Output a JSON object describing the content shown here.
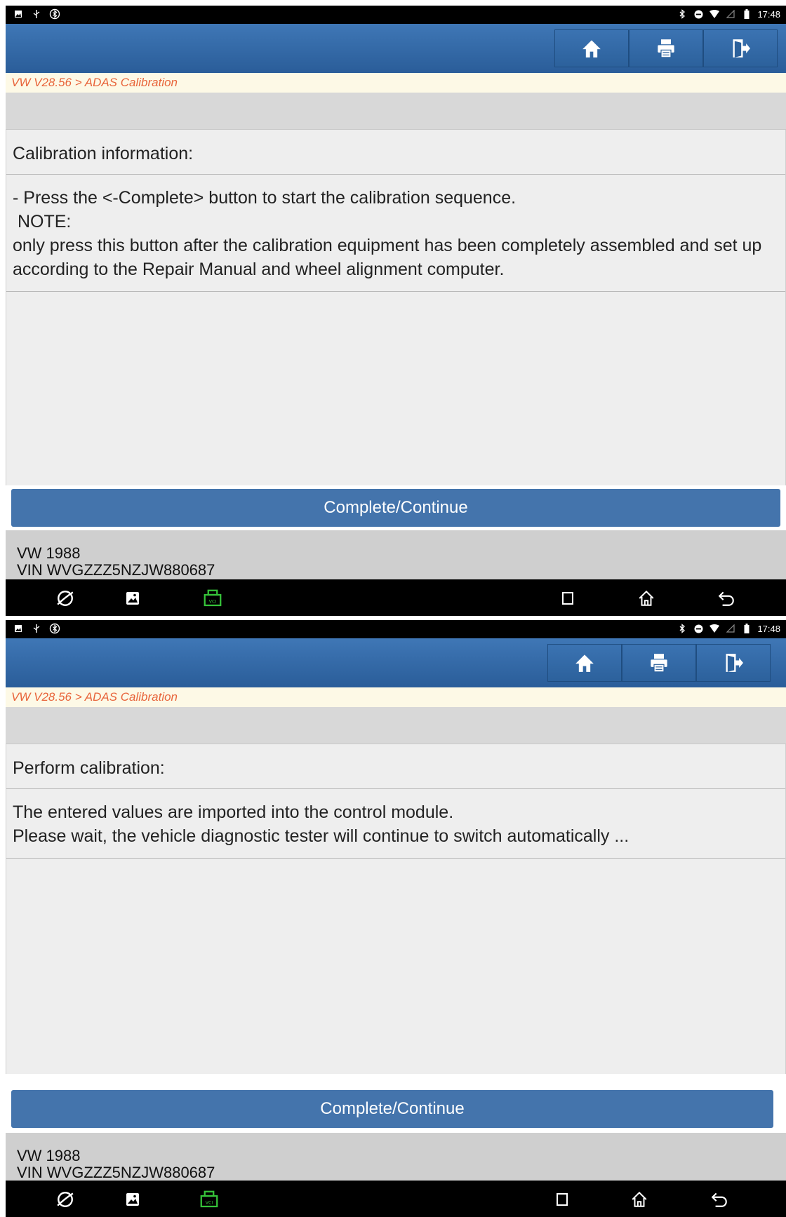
{
  "screens": [
    {
      "status_bar": {
        "time": "17:48"
      },
      "toolbar": {
        "home_icon": "home-icon",
        "print_icon": "printer-icon",
        "exit_icon": "exit-icon"
      },
      "breadcrumb": "VW V28.56 > ADAS Calibration",
      "section_title": "Calibration information:",
      "message_lines": [
        "- Press the <-Complete> button to start the calibration sequence.",
        " NOTE:",
        "only press this button after the calibration equipment has been completely assembled and set up according to the Repair Manual and wheel alignment computer."
      ],
      "primary_button": "Complete/Continue",
      "vehicle": {
        "model": "VW  1988",
        "vin": "VIN WVGZZZ5NZJW880687"
      }
    },
    {
      "status_bar": {
        "time": "17:48"
      },
      "toolbar": {
        "home_icon": "home-icon",
        "print_icon": "printer-icon",
        "exit_icon": "exit-icon"
      },
      "breadcrumb": "VW V28.56 > ADAS Calibration",
      "section_title": "Perform calibration:",
      "message_lines": [
        "The entered values are imported into the control module.",
        "Please wait, the vehicle diagnostic tester will continue to switch automatically ..."
      ],
      "primary_button": "Complete/Continue",
      "vehicle": {
        "model": "VW  1988",
        "vin": "VIN WVGZZZ5NZJW880687"
      }
    }
  ],
  "colors": {
    "header_blue": "#2f65a3",
    "button_blue": "#4474ac",
    "breadcrumb_text": "#e8643a",
    "vci_green": "#36c43a"
  }
}
